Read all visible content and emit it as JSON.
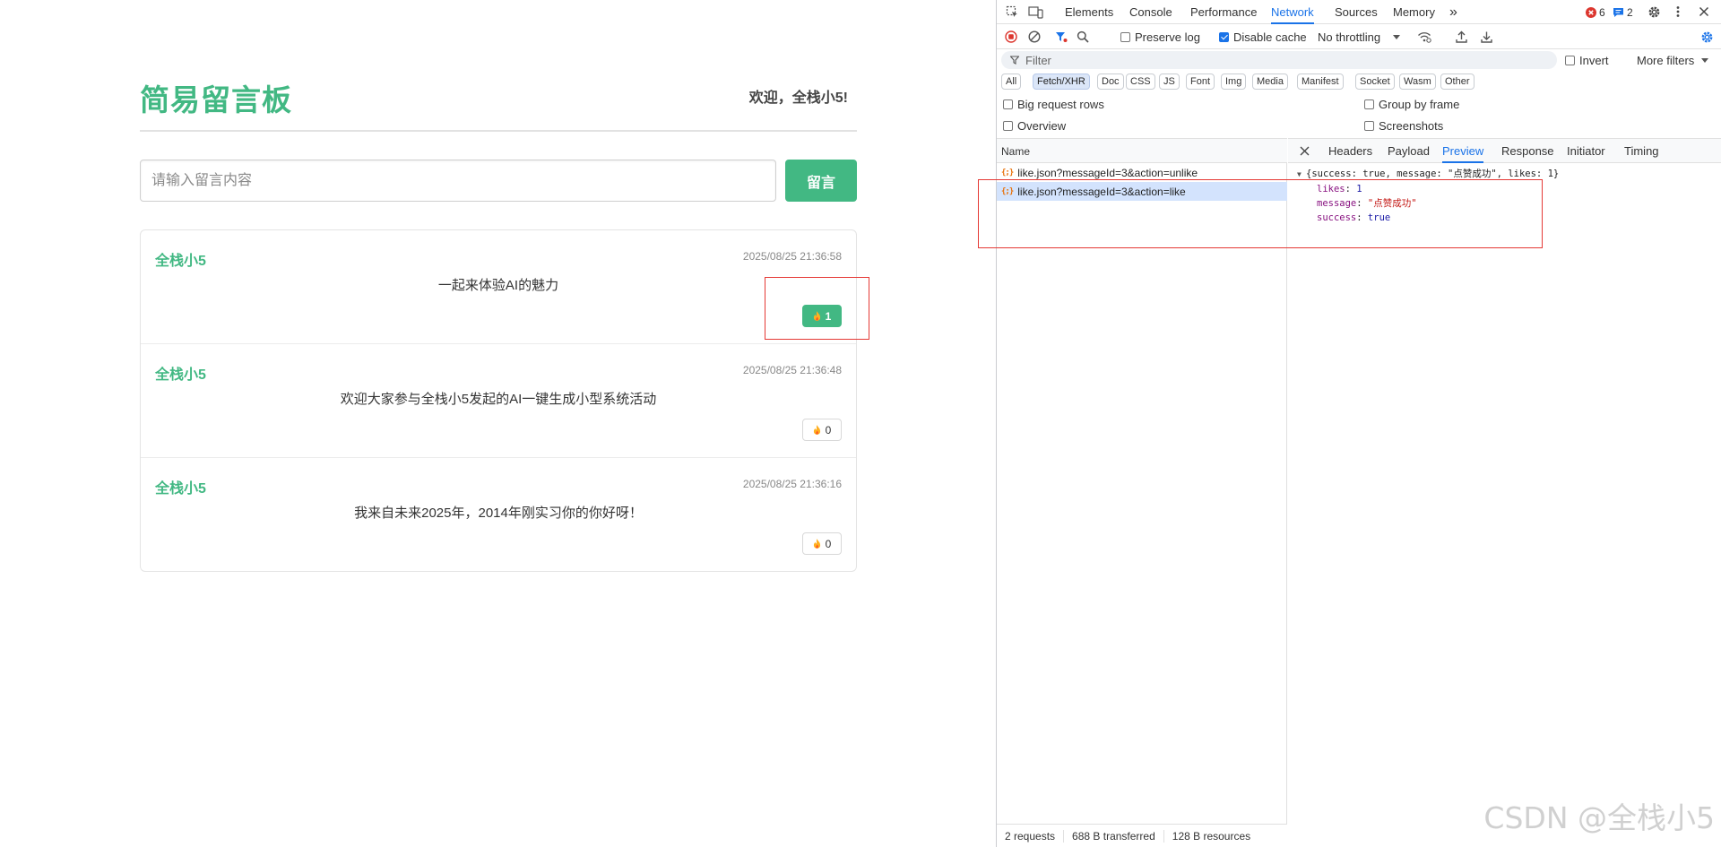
{
  "app": {
    "title": "简易留言板",
    "welcome": "欢迎，全栈小5!",
    "input_placeholder": "请输入留言内容",
    "post_button": "留言",
    "messages": [
      {
        "author": "全栈小5",
        "time": "2025/08/25 21:36:58",
        "content": "一起来体验AI的魅力",
        "likes": "1",
        "liked": true
      },
      {
        "author": "全栈小5",
        "time": "2025/08/25 21:36:48",
        "content": "欢迎大家参与全栈小5发起的AI一键生成小型系统活动",
        "likes": "0",
        "liked": false
      },
      {
        "author": "全栈小5",
        "time": "2025/08/25 21:36:16",
        "content": "我来自未来2025年，2014年刚实习你的你好呀！",
        "likes": "0",
        "liked": false
      }
    ],
    "accent_color": "#42b883"
  },
  "devtools": {
    "tabs": [
      "Elements",
      "Console",
      "Performance",
      "Network",
      "Sources",
      "Memory"
    ],
    "active_tab": "Network",
    "more_tabs": "»",
    "error_count": "6",
    "message_count": "2",
    "preserve_log": "Preserve log",
    "disable_cache": "Disable cache",
    "throttling": "No throttling",
    "filter_placeholder": "Filter",
    "invert": "Invert",
    "more_filters": "More filters",
    "type_filters": [
      "All",
      "Fetch/XHR",
      "Doc",
      "CSS",
      "JS",
      "Font",
      "Img",
      "Media",
      "Manifest",
      "Socket",
      "Wasm",
      "Other"
    ],
    "active_type": "Fetch/XHR",
    "options": {
      "big_request_rows": "Big request rows",
      "group_by_frame": "Group by frame",
      "overview": "Overview",
      "screenshots": "Screenshots"
    },
    "name_column": "Name",
    "requests": [
      "like.json?messageId=3&action=unlike",
      "like.json?messageId=3&action=like"
    ],
    "detail_tabs": [
      "Headers",
      "Payload",
      "Preview",
      "Response",
      "Initiator",
      "Timing"
    ],
    "active_detail_tab": "Preview",
    "preview": {
      "summary": "{success: true, message: \"点赞成功\", likes: 1}",
      "likes_key": "likes",
      "likes_value": "1",
      "message_key": "message",
      "message_value": "\"点赞成功\"",
      "success_key": "success",
      "success_value": "true"
    },
    "status": {
      "requests": "2 requests",
      "transferred": "688 B transferred",
      "resources": "128 B resources"
    }
  },
  "watermark": "CSDN @全栈小5"
}
